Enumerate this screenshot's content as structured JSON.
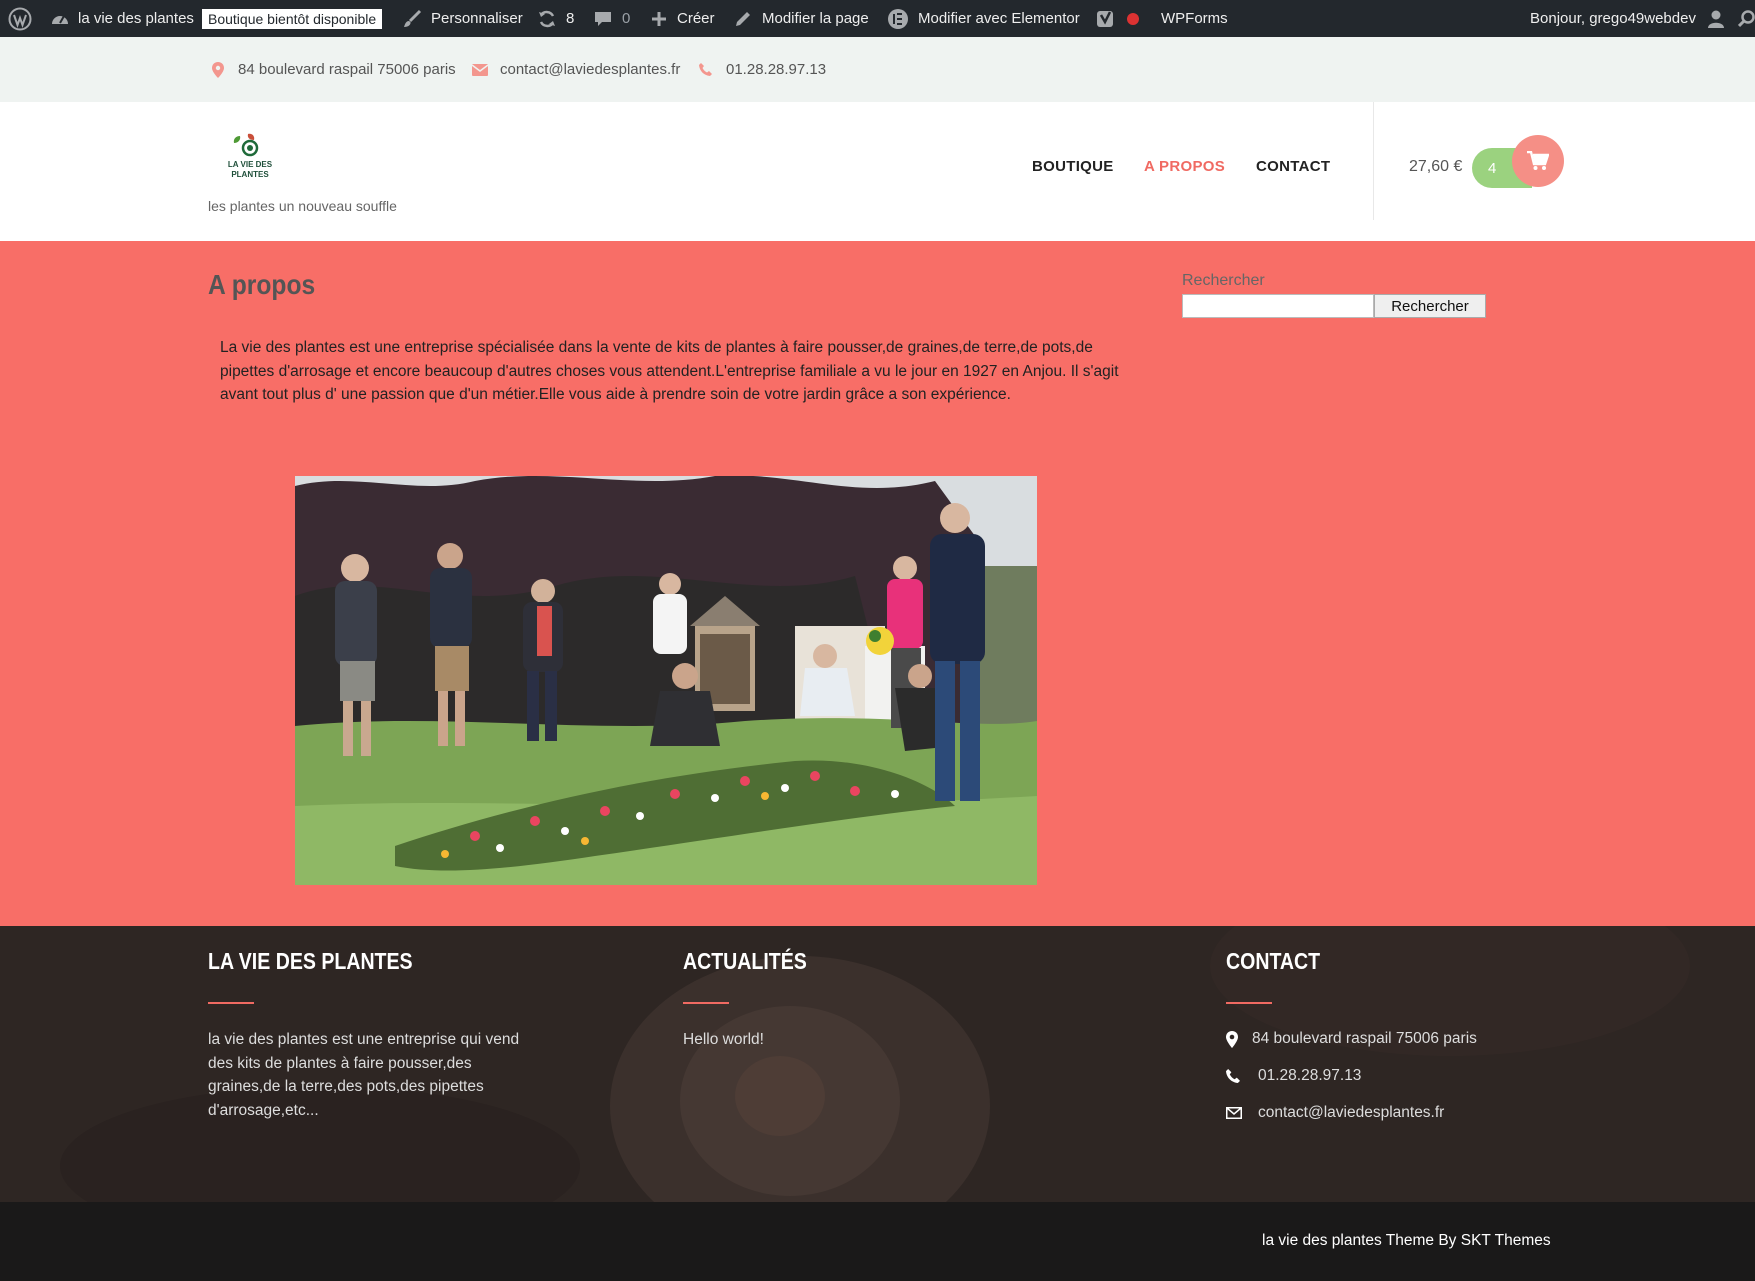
{
  "adminbar": {
    "site_name": "la vie des plantes",
    "badge": "Boutique bientôt disponible",
    "customize": "Personnaliser",
    "updates_count": "8",
    "comments_count": "0",
    "create": "Créer",
    "edit_page": "Modifier la page",
    "elementor": "Modifier avec Elementor",
    "wpforms": "WPForms",
    "greeting": "Bonjour, grego49webdev"
  },
  "topinfo": {
    "address": "84 boulevard raspail 75006 paris",
    "email": "contact@laviedesplantes.fr",
    "phone": "01.28.28.97.13",
    "icon_color": "#f3968e"
  },
  "header": {
    "logo_text_1": "LA VIE DES",
    "logo_text_2": "PLANTES",
    "tagline": "les plantes un nouveau souffle",
    "nav": [
      {
        "label": "BOUTIQUE"
      },
      {
        "label": "A PROPOS",
        "active": true
      },
      {
        "label": "CONTACT"
      }
    ],
    "cart_total": "27,60 €",
    "cart_count": "4",
    "accent": "#f06a62"
  },
  "main": {
    "background": "#f86e67",
    "title": "A propos",
    "intro": "La vie des plantes est une entreprise spécialisée dans la vente  de kits de plantes à faire pousser,de graines,de terre,de pots,de pipettes d'arrosage et encore beaucoup d'autres choses vous attendent.L'entreprise familiale  a vu le jour en 1927 en Anjou. Il s'agit avant  tout plus d' une passion que d'un métier.Elle  vous aide à prendre soin de votre jardin grâce a son expérience.",
    "search_label": "Rechercher",
    "search_button": "Rechercher"
  },
  "footer": {
    "col1_title": "LA VIE DES PLANTES",
    "col1_text": "la vie des plantes est une entreprise qui vend des kits de plantes à faire pousser,des graines,de la terre,des pots,des pipettes d'arrosage,etc...",
    "col2_title": "ACTUALITÉS",
    "col2_post": "Hello world!",
    "col3_title": "CONTACT",
    "address": "84 boulevard raspail 75006 paris",
    "phone": "01.28.28.97.13",
    "email": "contact@laviedesplantes.fr"
  },
  "credit": "la vie des plantes Theme By SKT Themes"
}
